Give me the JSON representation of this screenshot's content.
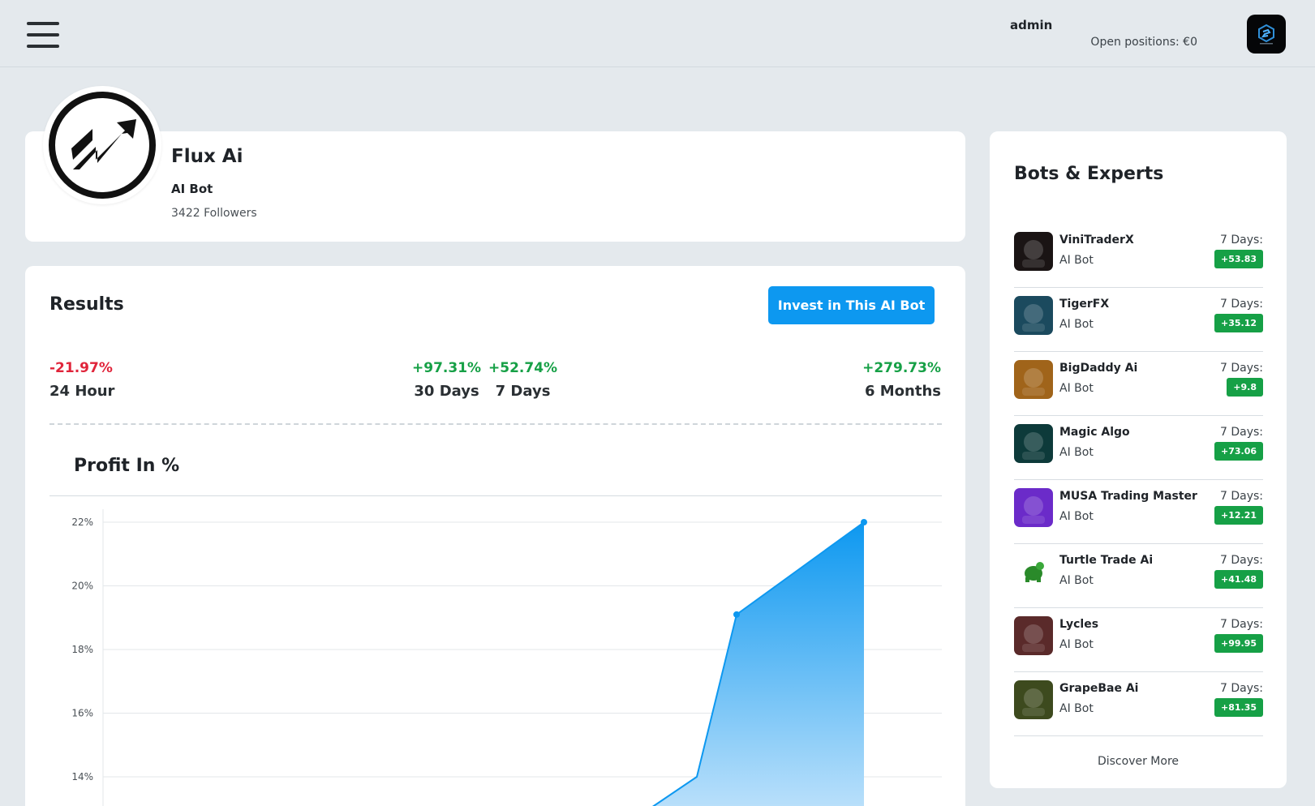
{
  "header": {
    "menu_icon": "hamburger-menu-icon",
    "user_name": "admin",
    "open_positions": "Open positions: €0",
    "avatar_icon": "brand-logo-icon"
  },
  "profile": {
    "name": "Flux Ai",
    "type": "AI Bot",
    "followers": "3422 Followers",
    "avatar_icon": "double-arrow-logo-icon"
  },
  "results": {
    "title": "Results",
    "invest_label": "Invest in This AI Bot",
    "stats": [
      {
        "value": "-21.97%",
        "label": "24 Hour",
        "tone": "negative"
      },
      {
        "value": "+97.31%",
        "label": "30 Days",
        "tone": "positive"
      },
      {
        "value": "+52.74%",
        "label": "7 Days",
        "tone": "positive"
      },
      {
        "value": "+279.73%",
        "label": "6 Months",
        "tone": "positive"
      }
    ]
  },
  "chart_data": {
    "type": "area",
    "title": "Profit In %",
    "xlabel": "",
    "ylabel": "",
    "y_ticks": [
      "22%",
      "20%",
      "18%",
      "16%",
      "14%"
    ],
    "y_tick_values": [
      22,
      20,
      18,
      16,
      14
    ],
    "ylim": [
      13,
      22
    ],
    "grid": true,
    "series": [
      {
        "x": [
          0,
          1,
          2,
          3
        ],
        "values": [
          13.0,
          14.0,
          19.1,
          22.0
        ]
      }
    ],
    "x_count": 4,
    "colors": {
      "line": "#0d98f0",
      "fill_top": "#0d98f0",
      "fill_bottom": "#bfe2fb"
    }
  },
  "sidebar": {
    "title": "Bots & Experts",
    "discover_label": "Discover More",
    "days_label": "7 Days:",
    "bots": [
      {
        "name": "ViniTraderX",
        "type": "AI Bot",
        "change": "+53.83",
        "thumb": "#1a1414"
      },
      {
        "name": "TigerFX",
        "type": "AI Bot",
        "change": "+35.12",
        "thumb": "#1b4a5e"
      },
      {
        "name": "BigDaddy Ai",
        "type": "AI Bot",
        "change": "+9.8",
        "thumb": "#a0641a"
      },
      {
        "name": "Magic Algo",
        "type": "AI Bot",
        "change": "+73.06",
        "thumb": "#0d3a3a"
      },
      {
        "name": "MUSA Trading Master",
        "type": "AI Bot",
        "change": "+12.21",
        "thumb": "#6b2bc9"
      },
      {
        "name": "Turtle Trade Ai",
        "type": "AI Bot",
        "change": "+41.48",
        "thumb": "#ffffff"
      },
      {
        "name": "Lycles",
        "type": "AI Bot",
        "change": "+99.95",
        "thumb": "#5a2a2a"
      },
      {
        "name": "GrapeBae Ai",
        "type": "AI Bot",
        "change": "+81.35",
        "thumb": "#3d4a1e"
      }
    ]
  }
}
